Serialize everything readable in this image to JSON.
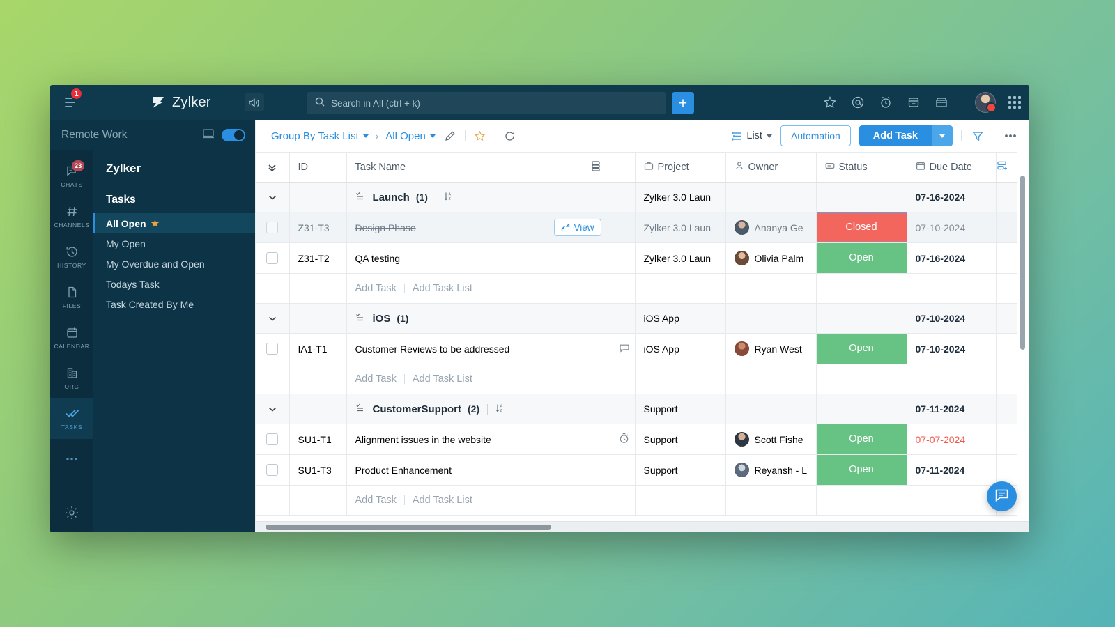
{
  "topbar": {
    "menu_badge": "1",
    "brand": "Zylker",
    "search_placeholder": "Search in All (ctrl + k)",
    "search_value": "",
    "add_label": "+",
    "icons": [
      "star-icon",
      "mention-icon",
      "alarm-icon",
      "archive-icon",
      "store-icon"
    ],
    "apps_icon": "apps-grid-icon"
  },
  "sidebar": {
    "workspace": "Remote Work",
    "rail": [
      {
        "label": "CHATS",
        "icon": "chat-icon",
        "badge": "23",
        "active": false
      },
      {
        "label": "CHANNELS",
        "icon": "hash-icon",
        "badge": "",
        "active": false
      },
      {
        "label": "HISTORY",
        "icon": "history-icon",
        "badge": "",
        "active": false
      },
      {
        "label": "FILES",
        "icon": "file-icon",
        "badge": "",
        "active": false
      },
      {
        "label": "CALENDAR",
        "icon": "calendar-icon",
        "badge": "",
        "active": false
      },
      {
        "label": "ORG",
        "icon": "org-icon",
        "badge": "",
        "active": false
      },
      {
        "label": "TASKS",
        "icon": "tasks-check-icon",
        "badge": "",
        "active": true
      }
    ],
    "more_label": "...",
    "org_title": "Zylker",
    "section_title": "Tasks",
    "items": [
      {
        "label": "All Open",
        "starred": true,
        "active": true
      },
      {
        "label": "My Open",
        "starred": false,
        "active": false
      },
      {
        "label": "My Overdue and Open",
        "starred": false,
        "active": false
      },
      {
        "label": "Todays Task",
        "starred": false,
        "active": false
      },
      {
        "label": "Task Created By Me",
        "starred": false,
        "active": false
      }
    ]
  },
  "toolbar": {
    "breadcrumb_group": "Group By Task List",
    "breadcrumb_view": "All Open",
    "edit_icon": "pencil-icon",
    "star_icon": "star-outline-icon",
    "refresh_icon": "refresh-icon",
    "view_mode": "List",
    "automation_label": "Automation",
    "add_task_label": "Add Task",
    "filter_icon": "filter-icon",
    "more_icon": "more-horizontal-icon"
  },
  "table": {
    "columns": [
      {
        "key": "chev",
        "label": "",
        "icon": "chevrons-down-icon"
      },
      {
        "key": "id",
        "label": "ID",
        "icon": ""
      },
      {
        "key": "task",
        "label": "Task Name",
        "icon": "subtask-icon"
      },
      {
        "key": "flag",
        "label": "",
        "icon": ""
      },
      {
        "key": "project",
        "label": "Project",
        "icon": "briefcase-icon"
      },
      {
        "key": "owner",
        "label": "Owner",
        "icon": "person-icon"
      },
      {
        "key": "status",
        "label": "Status",
        "icon": "tag-icon"
      },
      {
        "key": "due",
        "label": "Due Date",
        "icon": "calendar-icon"
      }
    ],
    "add_column_icon": "add-column-icon",
    "add_task_label": "Add Task",
    "add_task_list_label": "Add Task List",
    "groups": [
      {
        "name": "Launch",
        "count": "(1)",
        "sort_icon": "sort-az-icon",
        "project": "Zylker 3.0 Laun",
        "due": "07-16-2024",
        "rows": [
          {
            "id": "Z31-T3",
            "task": "Design Phase",
            "struck": true,
            "highlighted": true,
            "view_label": "View",
            "flag_icon": "",
            "project": "Zylker 3.0 Laun",
            "owner": "Ananya Ge",
            "avatar": "a1",
            "status": "Closed",
            "status_color": "#f2665e",
            "due": "07-10-2024",
            "due_overdue": false
          },
          {
            "id": "Z31-T2",
            "task": "QA testing",
            "struck": false,
            "highlighted": false,
            "view_label": "",
            "flag_icon": "",
            "project": "Zylker 3.0 Laun",
            "owner": "Olivia Palm",
            "avatar": "a2",
            "status": "Open",
            "status_color": "#66c383",
            "due": "07-16-2024",
            "due_overdue": false
          }
        ]
      },
      {
        "name": "iOS",
        "count": "(1)",
        "sort_icon": "",
        "project": "iOS App",
        "due": "07-10-2024",
        "rows": [
          {
            "id": "IA1-T1",
            "task": "Customer Reviews to be addressed",
            "struck": false,
            "highlighted": false,
            "view_label": "",
            "flag_icon": "comment-icon",
            "project": "iOS App",
            "owner": "Ryan West",
            "avatar": "a3",
            "status": "Open",
            "status_color": "#66c383",
            "due": "07-10-2024",
            "due_overdue": false
          }
        ]
      },
      {
        "name": "CustomerSupport",
        "count": "(2)",
        "sort_icon": "sort-az-icon",
        "project": "Support",
        "due": "07-11-2024",
        "rows": [
          {
            "id": "SU1-T1",
            "task": "Alignment issues in the website",
            "struck": false,
            "highlighted": false,
            "view_label": "",
            "flag_icon": "timer-icon",
            "project": "Support",
            "owner": "Scott Fishe",
            "avatar": "a4",
            "status": "Open",
            "status_color": "#66c383",
            "due": "07-07-2024",
            "due_overdue": true
          },
          {
            "id": "SU1-T3",
            "task": "Product Enhancement",
            "struck": false,
            "highlighted": false,
            "view_label": "",
            "flag_icon": "",
            "project": "Support",
            "owner": "Reyansh - L",
            "avatar": "a5",
            "status": "Open",
            "status_color": "#66c383",
            "due": "07-11-2024",
            "due_overdue": false
          }
        ]
      }
    ]
  },
  "chat_fab_icon": "chat-bubble-icon",
  "colors": {
    "accent": "#2a8fe0",
    "open": "#66c383",
    "closed": "#f2665e",
    "overdue": "#f2564b",
    "sidebar_bg": "#0d3446"
  }
}
